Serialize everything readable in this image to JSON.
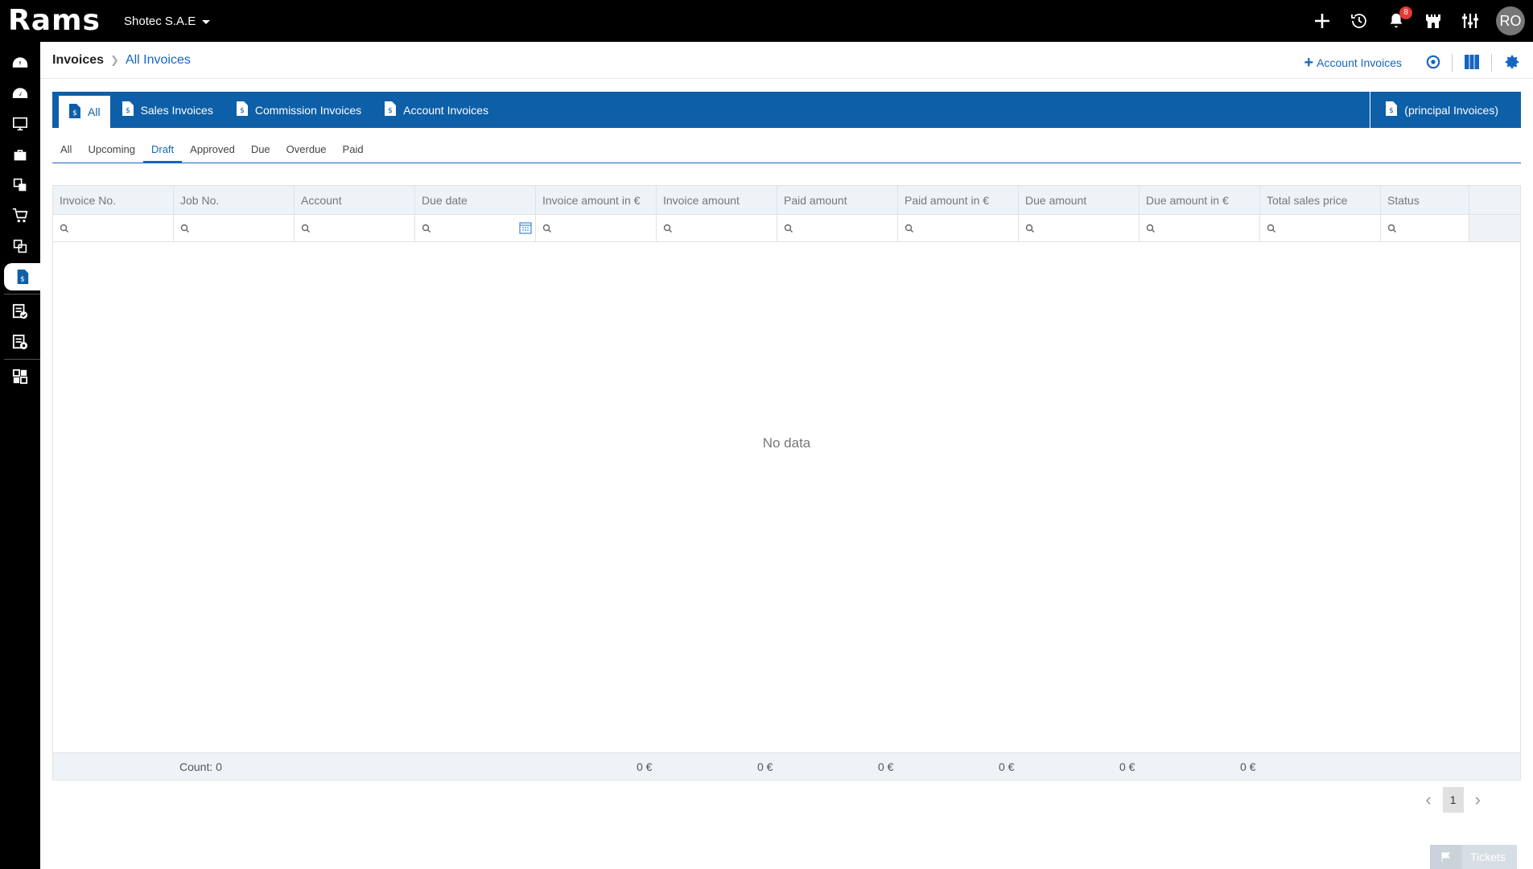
{
  "app": {
    "logo": "Rams",
    "company": "Shotec S.A.E"
  },
  "topbar": {
    "notifications_count": "8",
    "avatar_initials": "RO"
  },
  "breadcrumb": {
    "root": "Invoices",
    "current": "All Invoices"
  },
  "header_actions": {
    "add_label": "Account Invoices"
  },
  "tabs": [
    {
      "label": "All",
      "active": true
    },
    {
      "label": "Sales Invoices"
    },
    {
      "label": "Commission Invoices"
    },
    {
      "label": "Account Invoices"
    }
  ],
  "tab_right": "(principal Invoices)",
  "subtabs": [
    "All",
    "Upcoming",
    "Draft",
    "Approved",
    "Due",
    "Overdue",
    "Paid"
  ],
  "active_subtab": "Draft",
  "columns": [
    "Invoice No.",
    "Job No.",
    "Account",
    "Due date",
    "Invoice amount in €",
    "Invoice amount",
    "Paid amount",
    "Paid amount in €",
    "Due amount",
    "Due amount in €",
    "Total sales price",
    "Status"
  ],
  "grid": {
    "empty_text": "No data",
    "footer": {
      "count": "Count: 0",
      "totals": [
        "0 €",
        "0 €",
        "0 €",
        "0 €",
        "0 €",
        "0 €"
      ]
    }
  },
  "pagination": {
    "current": "1"
  },
  "tickets": {
    "label": "Tickets"
  },
  "colors": {
    "primary": "#0d5fa8",
    "link": "#1565c0",
    "topbar": "#000000",
    "badge": "#e53935"
  }
}
